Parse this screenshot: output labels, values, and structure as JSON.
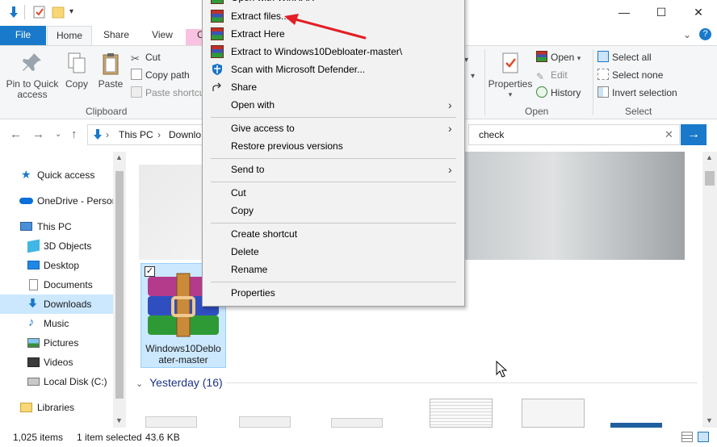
{
  "window": {
    "minimize": "—",
    "maximize": "☐",
    "close": "✕",
    "help": "?",
    "collapse_ribbon": "⌄"
  },
  "tabs": {
    "file": "File",
    "home": "Home",
    "share": "Share",
    "view": "View",
    "partial": "C"
  },
  "ribbon": {
    "pin_to_quick_access": "Pin to Quick access",
    "copy": "Copy",
    "paste": "Paste",
    "cut": "Cut",
    "copy_path": "Copy path",
    "paste_shortcut": "Paste shortcut",
    "clipboard_group": "Clipboard",
    "properties": "Properties",
    "open": "Open",
    "edit": "Edit",
    "history": "History",
    "open_group": "Open",
    "select_all": "Select all",
    "select_none": "Select none",
    "invert_selection": "Invert selection",
    "select_group": "Select"
  },
  "address": {
    "this_pc": "This PC",
    "downloads": "Downlo",
    "search_value": "check"
  },
  "nav_pane": {
    "quick_access": "Quick access",
    "onedrive": "OneDrive - Persor",
    "this_pc": "This PC",
    "objects_3d": "3D Objects",
    "desktop": "Desktop",
    "documents": "Documents",
    "downloads": "Downloads",
    "music": "Music",
    "pictures": "Pictures",
    "videos": "Videos",
    "local_disk": "Local Disk (C:)",
    "libraries": "Libraries"
  },
  "content": {
    "selected_item_line1": "Windows10Deblo",
    "selected_item_line2": "ater-master",
    "group_header": "Yesterday (16)"
  },
  "status": {
    "item_count": "1,025 items",
    "selection": "1 item selected",
    "size": "43.6 KB"
  },
  "context_menu": {
    "open_with_winrar": "Open with WinRAR",
    "extract_files": "Extract files...",
    "extract_here": "Extract Here",
    "extract_to": "Extract to Windows10Debloater-master\\",
    "scan_defender": "Scan with Microsoft Defender...",
    "share": "Share",
    "open_with": "Open with",
    "give_access": "Give access to",
    "restore_versions": "Restore previous versions",
    "send_to": "Send to",
    "cut": "Cut",
    "copy": "Copy",
    "create_shortcut": "Create shortcut",
    "delete": "Delete",
    "rename": "Rename",
    "properties": "Properties"
  },
  "colors": {
    "accent": "#1979ca",
    "annotation_arrow": "#e31e24",
    "selection": "#cce8ff"
  }
}
